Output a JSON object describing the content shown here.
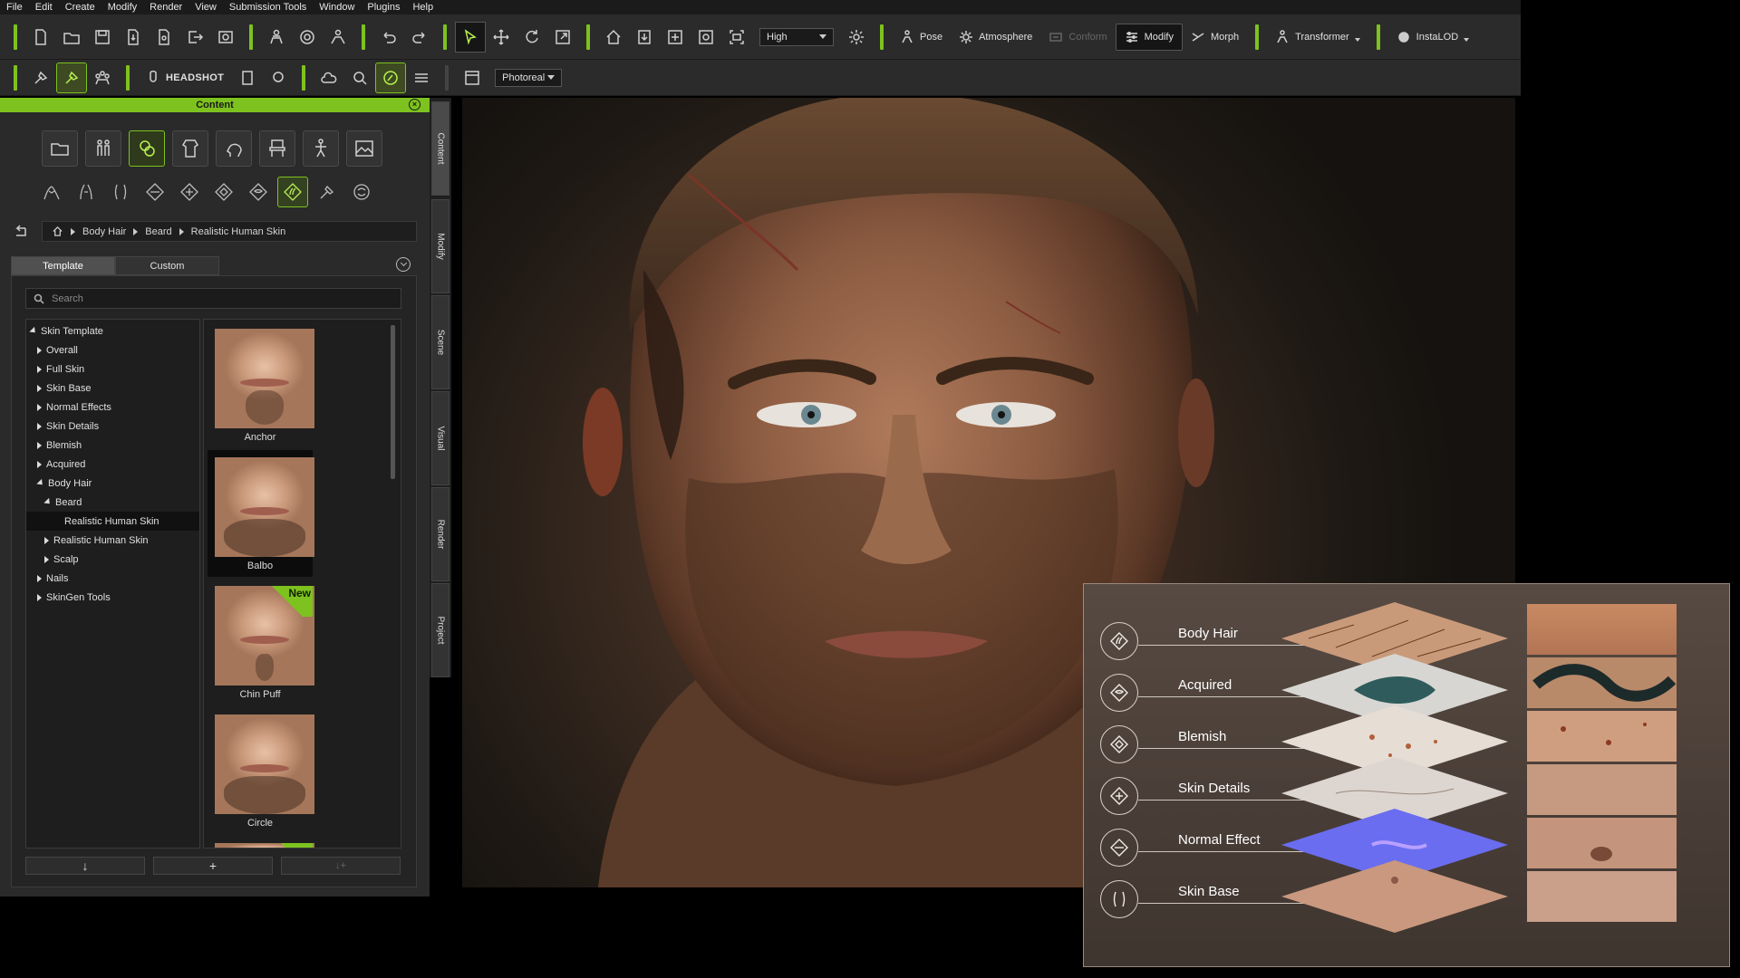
{
  "menu": [
    "File",
    "Edit",
    "Create",
    "Modify",
    "Render",
    "View",
    "Submission Tools",
    "Window",
    "Plugins",
    "Help"
  ],
  "toolbar": {
    "quality_select": "High",
    "pose": "Pose",
    "atmosphere": "Atmosphere",
    "conform": "Conform",
    "modify": "Modify",
    "morph": "Morph",
    "transformer": "Transformer",
    "instalod": "InstaLOD",
    "headshot": "HEADSHOT",
    "render_mode": "Photoreal"
  },
  "panel": {
    "title": "Content",
    "breadcrumb": [
      "Body Hair",
      "Beard",
      "Realistic Human Skin"
    ],
    "tabs": [
      "Template",
      "Custom"
    ],
    "search_placeholder": "Search",
    "tree": [
      {
        "label": "Skin Template",
        "level": 0,
        "state": "expanded"
      },
      {
        "label": "Overall",
        "level": 1,
        "state": "collapsed"
      },
      {
        "label": "Full Skin",
        "level": 1,
        "state": "collapsed"
      },
      {
        "label": "Skin Base",
        "level": 1,
        "state": "collapsed"
      },
      {
        "label": "Normal Effects",
        "level": 1,
        "state": "collapsed"
      },
      {
        "label": "Skin Details",
        "level": 1,
        "state": "collapsed"
      },
      {
        "label": "Blemish",
        "level": 1,
        "state": "collapsed"
      },
      {
        "label": "Acquired",
        "level": 1,
        "state": "collapsed"
      },
      {
        "label": "Body Hair",
        "level": 1,
        "state": "expanded"
      },
      {
        "label": "Beard",
        "level": 2,
        "state": "expanded"
      },
      {
        "label": "Realistic Human Skin",
        "level": 3,
        "state": "selected"
      },
      {
        "label": "Realistic Human Skin",
        "level": 2,
        "state": "collapsed"
      },
      {
        "label": "Scalp",
        "level": 2,
        "state": "collapsed"
      },
      {
        "label": "Nails",
        "level": 1,
        "state": "collapsed"
      },
      {
        "label": "SkinGen Tools",
        "level": 1,
        "state": "collapsed"
      }
    ],
    "thumbnails": [
      {
        "label": "Anchor",
        "is_new": false,
        "selected": false
      },
      {
        "label": "Balbo",
        "is_new": false,
        "selected": true
      },
      {
        "label": "Chin Puff",
        "is_new": true,
        "selected": false
      },
      {
        "label": "Circle",
        "is_new": false,
        "selected": false
      }
    ],
    "new_badge": "New",
    "side_tabs": [
      "Content",
      "Modify",
      "Scene",
      "Visual",
      "Render",
      "Project"
    ]
  },
  "layers": {
    "items": [
      {
        "name": "Body Hair",
        "icon": "body-hair-icon"
      },
      {
        "name": "Acquired",
        "icon": "acquired-icon"
      },
      {
        "name": "Blemish",
        "icon": "blemish-icon"
      },
      {
        "name": "Skin Details",
        "icon": "skin-details-icon"
      },
      {
        "name": "Normal Effect",
        "icon": "normal-effect-icon"
      },
      {
        "name": "Skin Base",
        "icon": "skin-base-icon"
      }
    ]
  },
  "colors": {
    "accent": "#7dc21e",
    "panel_bg": "#2a2a2a"
  }
}
